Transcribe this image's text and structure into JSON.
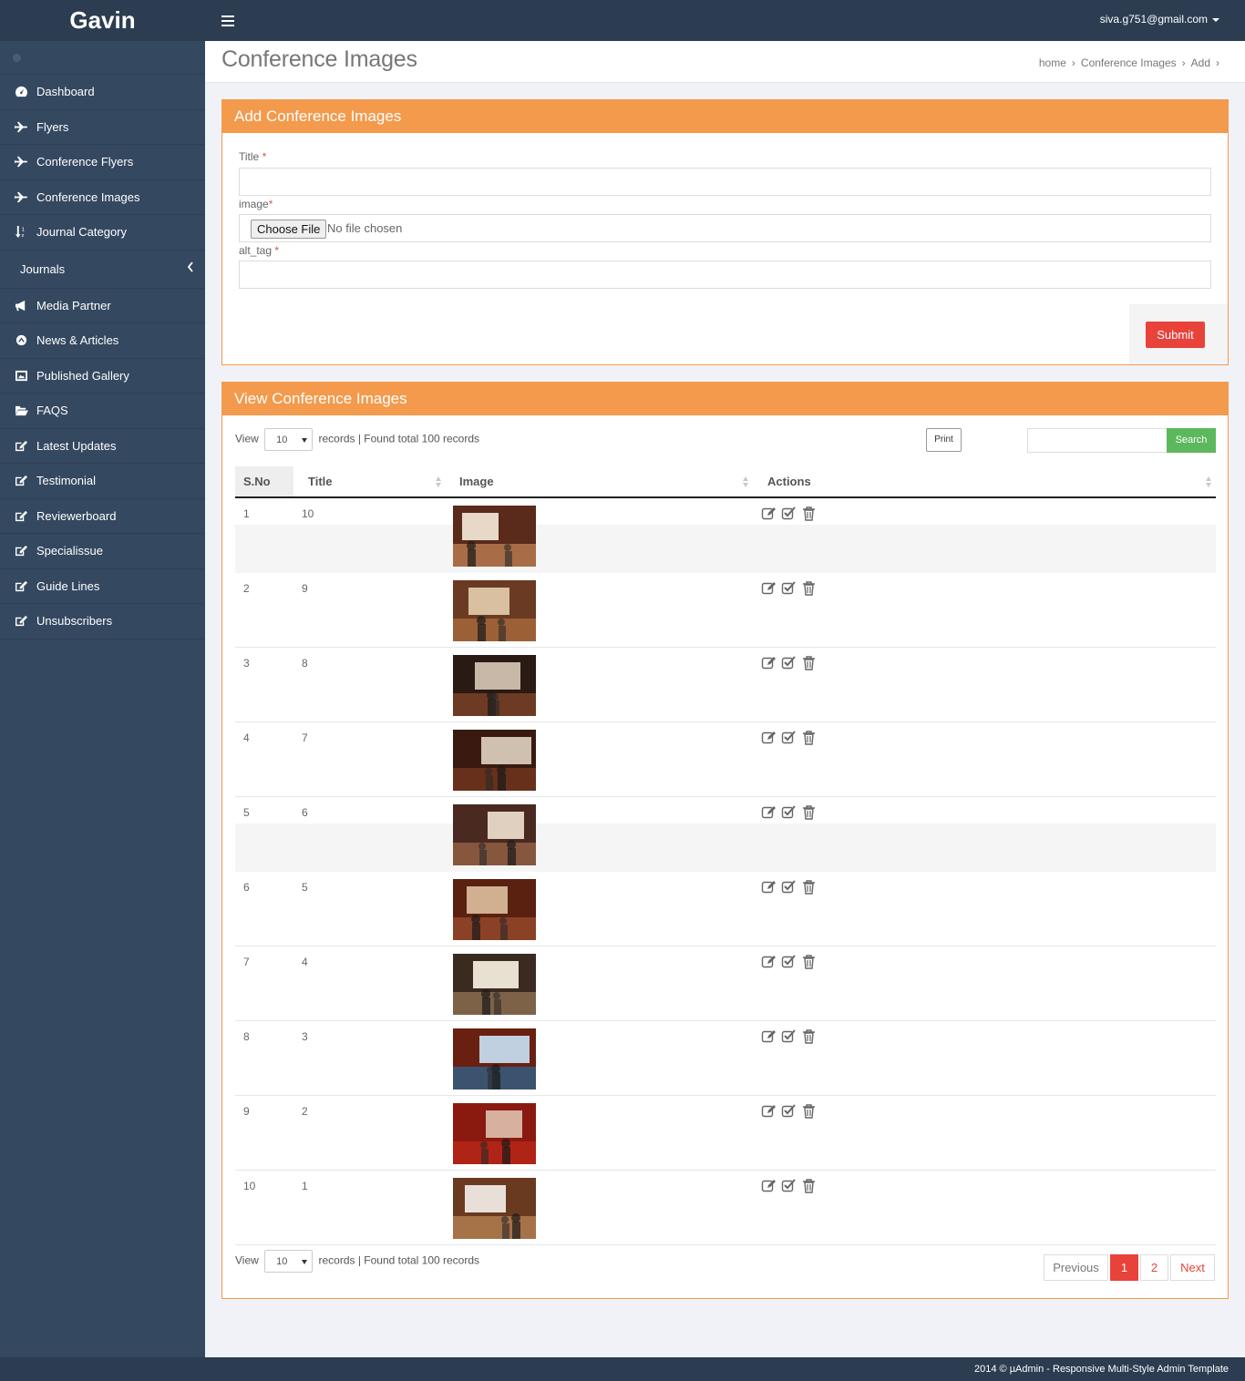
{
  "brand": "Gavin",
  "user": {
    "email": "siva.g751@gmail.com"
  },
  "page": {
    "title": "Conference Images"
  },
  "breadcrumb": [
    "home",
    "Conference Images",
    "Add"
  ],
  "sidebar": {
    "items": [
      {
        "label": "Dashboard",
        "icon": "dashboard-icon"
      },
      {
        "label": "Flyers",
        "icon": "plane-icon"
      },
      {
        "label": "Conference Flyers",
        "icon": "plane-icon"
      },
      {
        "label": "Conference Images",
        "icon": "plane-icon"
      },
      {
        "label": "Journal Category",
        "icon": "sort-icon"
      },
      {
        "label": "Journals",
        "icon": "chevron-left-icon"
      },
      {
        "label": "Media Partner",
        "icon": "megaphone-icon"
      },
      {
        "label": "News & Articles",
        "icon": "circle-icon"
      },
      {
        "label": "Published Gallery",
        "icon": "image-icon"
      },
      {
        "label": "FAQS",
        "icon": "folder-open-icon"
      },
      {
        "label": "Latest Updates",
        "icon": "edit-icon"
      },
      {
        "label": "Testimonial",
        "icon": "edit-icon"
      },
      {
        "label": "Reviewerboard",
        "icon": "edit-icon"
      },
      {
        "label": "Specialissue",
        "icon": "edit-icon"
      },
      {
        "label": "Guide Lines",
        "icon": "edit-icon"
      },
      {
        "label": "Unsubscribers",
        "icon": "edit-icon"
      }
    ]
  },
  "add_form": {
    "heading": "Add Conference Images",
    "title_label": "Title",
    "title_value": "",
    "image_label": "image",
    "file_button": "Choose File",
    "file_status": "No file chosen",
    "alt_label": "alt_tag",
    "alt_value": "",
    "required_mark": "*",
    "submit_label": "Submit"
  },
  "view": {
    "heading": "View Conference Images",
    "view_label": "View",
    "per_page": "10",
    "records_text": "records | Found total 100 records",
    "print_label": "Print",
    "search_value": "",
    "search_label": "Search",
    "columns": [
      "S.No",
      "Title",
      "Image",
      "Actions"
    ],
    "rows": [
      {
        "sno": "1",
        "title": "10"
      },
      {
        "sno": "2",
        "title": "9"
      },
      {
        "sno": "3",
        "title": "8"
      },
      {
        "sno": "4",
        "title": "7"
      },
      {
        "sno": "5",
        "title": "6"
      },
      {
        "sno": "6",
        "title": "5"
      },
      {
        "sno": "7",
        "title": "4"
      },
      {
        "sno": "8",
        "title": "3"
      },
      {
        "sno": "9",
        "title": "2"
      },
      {
        "sno": "10",
        "title": "1"
      }
    ],
    "pagination": {
      "previous": "Previous",
      "pages": [
        "1",
        "2"
      ],
      "next": "Next",
      "current": "1"
    }
  },
  "footer": {
    "text": "2014 © µAdmin - Responsive Multi-Style Admin Template"
  },
  "colors": {
    "accent": "#f39a4c",
    "danger": "#e8423a",
    "success": "#5cb85c",
    "sidebar": "#344860",
    "topbar": "#2c3d51"
  }
}
